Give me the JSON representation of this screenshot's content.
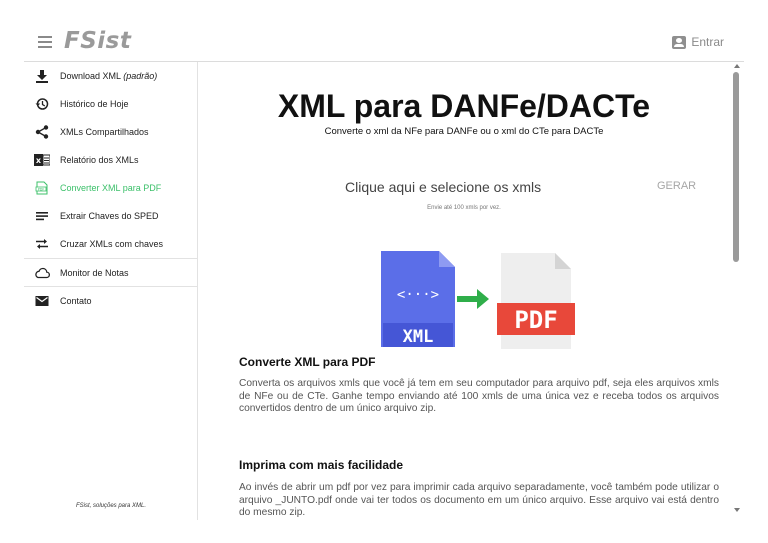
{
  "header": {
    "logo": "FSist",
    "enter_label": "Entrar",
    "menu_icon": "hamburger-icon",
    "user_icon": "user-icon"
  },
  "sidebar": {
    "items": [
      {
        "label": "Download XML",
        "suffix": "(padrão)",
        "icon": "download-icon"
      },
      {
        "label": "Histórico de Hoje",
        "icon": "history-icon"
      },
      {
        "label": "XMLs Compartilhados",
        "icon": "share-icon"
      },
      {
        "label": "Relatório dos XMLs",
        "icon": "excel-icon"
      },
      {
        "label": "Converter XML para PDF",
        "icon": "pdf-file-icon",
        "active": true
      },
      {
        "label": "Extrair Chaves do SPED",
        "icon": "lines-icon"
      },
      {
        "label": "Cruzar XMLs com chaves",
        "icon": "swap-icon"
      },
      {
        "label": "Monitor de Notas",
        "icon": "cloud-icon"
      },
      {
        "label": "Contato",
        "icon": "mail-icon"
      }
    ],
    "footer": "FSist, soluções para XML."
  },
  "main": {
    "title": "XML para DANFe/DACTe",
    "subtitle": "Converte o xml da NFe para DANFe ou o xml do CTe para DACTe",
    "select_label": "Clique aqui e selecione os xmls",
    "gerar_label": "GERAR",
    "hint": "Envie até 100 xmls por vez.",
    "illustration": {
      "from_label": "XML",
      "to_label": "PDF",
      "code_symbol": "<···>"
    },
    "sections": [
      {
        "title": "Converte XML para PDF",
        "body": "Converta os arquivos xmls que você já tem em seu computador para arquivo pdf, seja eles arquivos xmls de NFe ou de CTe. Ganhe tempo enviando até 100 xmls de uma única vez e receba todos os arquivos convertidos dentro de um único arquivo zip."
      },
      {
        "title": "Imprima com mais facilidade",
        "body": "Ao invés de abrir um pdf por vez para imprimir cada arquivo separadamente, você também pode utilizar o arquivo _JUNTO.pdf onde vai ter todos os documento em um único arquivo. Esse arquivo vai está dentro do mesmo zip."
      }
    ]
  },
  "colors": {
    "accent_green": "#3cc06a",
    "xml_blue": "#5b6ee8",
    "pdf_red": "#e8483a",
    "arrow_green": "#2fae4a"
  }
}
